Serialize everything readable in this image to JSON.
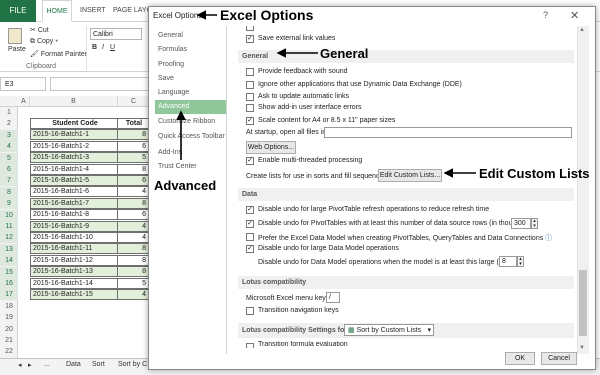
{
  "excel": {
    "ribbon_tabs": [
      "FILE",
      "HOME",
      "INSERT",
      "PAGE LAYOU"
    ],
    "clipboard": {
      "paste": "Paste",
      "cut": "Cut",
      "copy": "Copy",
      "format_painter": "Format Painter",
      "group": "Clipboard"
    },
    "font_name": "Calibri",
    "name_box": "E3",
    "columns": [
      "A",
      "B",
      "C"
    ],
    "rows": [
      "1",
      "2",
      "3",
      "4",
      "5",
      "6",
      "7",
      "8",
      "9",
      "10",
      "11",
      "12",
      "13",
      "14",
      "15",
      "16",
      "17",
      "18",
      "19",
      "20",
      "21",
      "22"
    ],
    "table": {
      "headers": [
        "Student Code",
        "Total"
      ],
      "rows": [
        [
          "2015-16-Batch1-1",
          "8"
        ],
        [
          "2015-16-Batch1-2",
          "6"
        ],
        [
          "2015-16-Batch1-3",
          "5"
        ],
        [
          "2015-16-Batch1-4",
          "8"
        ],
        [
          "2015-16-Batch1-5",
          "6"
        ],
        [
          "2015-16-Batch1-6",
          "4"
        ],
        [
          "2015-16-Batch1-7",
          "8"
        ],
        [
          "2015-16-Batch1-8",
          "6"
        ],
        [
          "2015-16-Batch1-9",
          "4"
        ],
        [
          "2015-16-Batch1-10",
          "4"
        ],
        [
          "2015-16-Batch1-11",
          "8"
        ],
        [
          "2015-16-Batch1-12",
          "8"
        ],
        [
          "2015-16-Batch1-13",
          "8"
        ],
        [
          "2015-16-Batch1-14",
          "5"
        ],
        [
          "2015-16-Batch1-15",
          "4"
        ]
      ]
    },
    "sheet_tabs": [
      "◂",
      "▸",
      "...",
      "Data",
      "Sort",
      "Sort by C"
    ]
  },
  "dialog": {
    "title": "Excel Options",
    "help": "?",
    "close": "✕",
    "nav": [
      "General",
      "Formulas",
      "Proofing",
      "Save",
      "Language",
      "Advanced",
      "Customize Ribbon",
      "Quick Access Toolbar",
      "Add-Ins",
      "Trust Center"
    ],
    "save_external": "Save external link values",
    "general_section": "General",
    "general_options": [
      "Provide feedback with sound",
      "Ignore other applications that use Dynamic Data Exchange (DDE)",
      "Ask to update automatic links",
      "Show add-in user interface errors",
      "Scale content for A4 or 8.5 x 11\" paper sizes"
    ],
    "startup_label": "At startup, open all files in:",
    "web_options": "Web Options...",
    "multithreaded": "Enable multi-threaded processing",
    "custom_lists_label": "Create lists for use in sorts and fill sequences:",
    "edit_custom_lists": "Edit Custom Lists...",
    "data_section": "Data",
    "data_opt1": "Disable undo for large PivotTable refresh operations to reduce refresh time",
    "data_opt2": "Disable undo for PivotTables with at least this number of data source rows (in thousands):",
    "data_opt2_value": "300",
    "data_opt3": "Prefer the Excel Data Model when creating PivotTables, QueryTables and Data Connections",
    "data_opt4": "Disable undo for large Data Model operations",
    "data_opt5": "Disable undo for Data Model operations when the model is at least this large (in MB):",
    "data_opt5_value": "8",
    "lotus_section": "Lotus compatibility",
    "lotus_menu_key_label": "Microsoft Excel menu key:",
    "lotus_menu_key_value": "/",
    "transition_nav": "Transition navigation keys",
    "lotus_settings_label": "Lotus compatibility Settings for:",
    "lotus_settings_value": "Sort by Custom Lists",
    "transition_formula": "Transition formula evaluation",
    "ok": "OK",
    "cancel": "Cancel"
  },
  "annotations": {
    "excel_options": "Excel Options",
    "general": "General",
    "advanced": "Advanced",
    "edit_custom_lists": "Edit Custom Lists"
  },
  "colors": {
    "excel_green": "#217346",
    "nav_selected": "#8fc79b",
    "table_alt_row": "#e2efda"
  }
}
